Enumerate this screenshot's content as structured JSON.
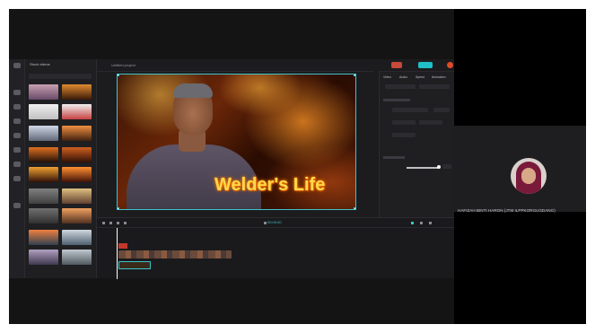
{
  "editor": {
    "panel_title": "Stock videos",
    "project_name": "Untitled project",
    "overlay_title": "Welder's Life",
    "export_label": "Export",
    "property_tabs": [
      "Video",
      "Audio",
      "Speed",
      "Animation"
    ],
    "timecode": "00:00:00"
  },
  "participant": {
    "name": "HAFIZAH BINTI HARON (JTM ILPPKORGUGDANG)"
  },
  "colors": {
    "accent": "#1fc1c6",
    "title_text": "#ffd84a",
    "clip_label": "#c0392b"
  }
}
